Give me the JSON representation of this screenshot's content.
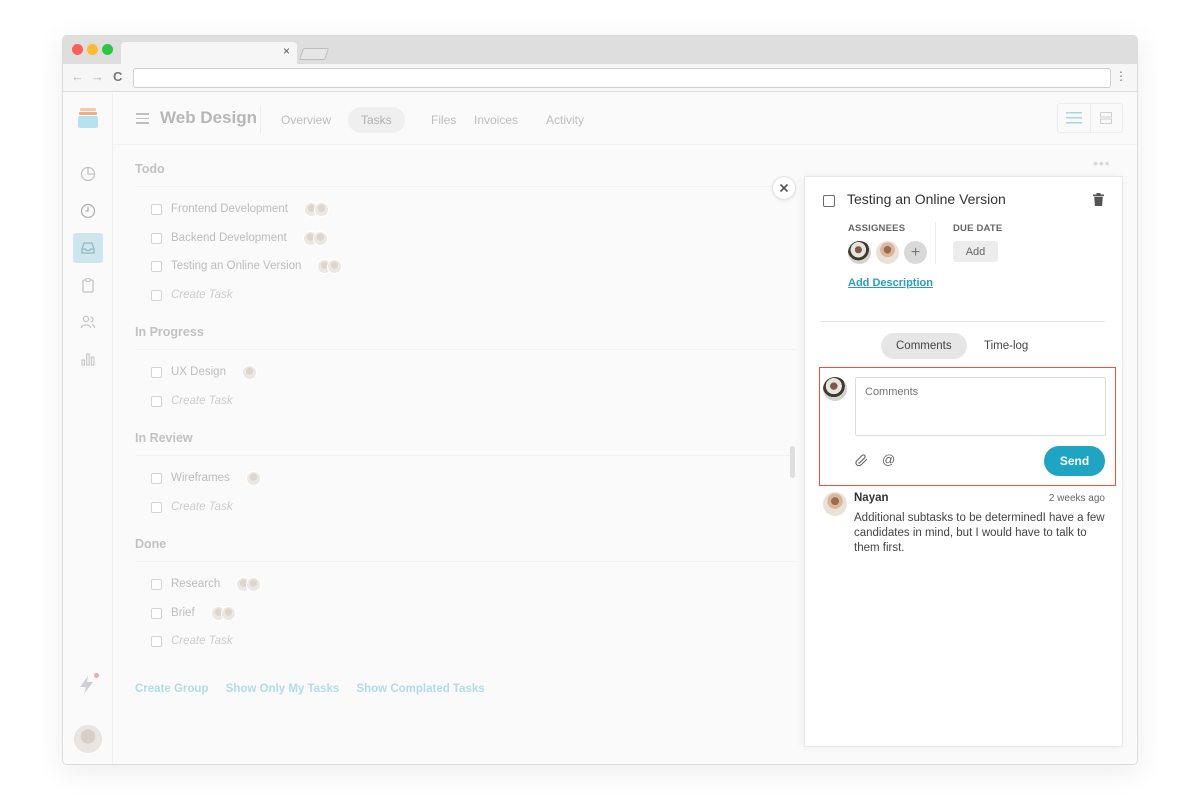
{
  "browser": {
    "tab_close_glyph": "×",
    "back_glyph": "←",
    "forward_glyph": "→",
    "reload_glyph": "C",
    "menu_glyph": "⋮",
    "url": ""
  },
  "header": {
    "project_title": "Web Design",
    "tabs": [
      {
        "label": "Overview"
      },
      {
        "label": "Tasks",
        "active": true
      },
      {
        "label": "Files"
      },
      {
        "label": "Invoices"
      },
      {
        "label": "Activity"
      }
    ]
  },
  "groups": [
    {
      "title": "Todo",
      "tasks": [
        {
          "label": "Frontend Development",
          "assignees": 2
        },
        {
          "label": "Backend Development",
          "assignees": 2
        },
        {
          "label": "Testing an Online Version",
          "assignees": 2
        },
        {
          "label": "Create Task",
          "placeholder": true
        }
      ]
    },
    {
      "title": "In Progress",
      "tasks": [
        {
          "label": "UX Design",
          "assignees": 1
        },
        {
          "label": "Create Task",
          "placeholder": true
        }
      ]
    },
    {
      "title": "In Review",
      "tasks": [
        {
          "label": "Wireframes",
          "assignees": 1
        },
        {
          "label": "Create Task",
          "placeholder": true
        }
      ]
    },
    {
      "title": "Done",
      "tasks": [
        {
          "label": "Research",
          "assignees": 2
        },
        {
          "label": "Brief",
          "assignees": 2
        },
        {
          "label": "Create Task",
          "placeholder": true
        }
      ]
    }
  ],
  "footer": {
    "create_group": "Create Group",
    "show_only_my_tasks": "Show Only My Tasks",
    "show_completed_tasks": "Show Complated Tasks"
  },
  "panel": {
    "close_glyph": "×",
    "task_title": "Testing an Online Version",
    "assignees_label": "ASSIGNEES",
    "due_date_label": "DUE DATE",
    "add_date_label": "Add",
    "add_assignee_glyph": "+",
    "add_description": "Add Description",
    "tabs": [
      {
        "label": "Comments",
        "active": true
      },
      {
        "label": "Time-log"
      }
    ],
    "comment_placeholder": "Comments",
    "at_glyph": "@",
    "send_label": "Send",
    "comments": [
      {
        "author": "Nayan",
        "time": "2 weeks ago",
        "body": "Additional subtasks to be determinedI have a few candidates in mind, but I would have to talk to them first."
      }
    ]
  },
  "colors": {
    "accent": "#1fa5c4",
    "highlight_border": "#e7553f",
    "sidebar_active": "#cfe6ec"
  }
}
